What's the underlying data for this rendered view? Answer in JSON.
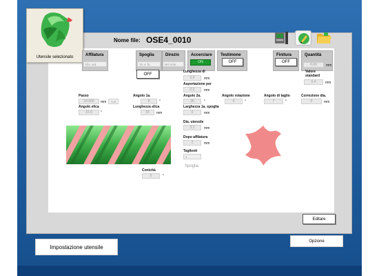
{
  "tool_card": {
    "caption": "Utensile selezionato"
  },
  "header": {
    "file_label": "Nome file:",
    "file_value": "OSE4_0010"
  },
  "columns": {
    "affilatura": {
      "label": "Affilatura",
      "value": "Ris. aut"
    },
    "spoglia": {
      "label": "Spoglia",
      "value": "Ta. e Ta",
      "off": "OFF"
    },
    "direzione": {
      "label": "Direzio",
      "value": "Nel sole"
    },
    "accerciare": {
      "label": "Accerciare",
      "value": "ON"
    },
    "testimone": {
      "label": "Testimone",
      "off": "OFF"
    },
    "finitura": {
      "label": "Finitura",
      "off": "OFF"
    },
    "quantita": {
      "label": "Quantità",
      "value": "0.00",
      "unit": "mm"
    }
  },
  "fields": {
    "lunghezza_di": {
      "label": "Lunghezza di",
      "value": "0.0",
      "unit": "mm"
    },
    "valore_standard": {
      "label": "Valore standard",
      "value": "0.4",
      "unit": "mm"
    },
    "asportazione_per": {
      "label": "Asportazione per",
      "value": "0.2",
      "unit": "mm"
    },
    "passo": {
      "label": "Passo",
      "value": "10.000",
      "unit": "mm",
      "calc": "Cal"
    },
    "angolo_1a": {
      "label": "Angolo 1a.",
      "value": "8",
      "unit": "°"
    },
    "angolo_2a": {
      "label": "Angolo 2a.",
      "value": "26",
      "unit": "°"
    },
    "angolo_rotazione": {
      "label": "Angolo rotazione",
      "value": "0",
      "unit": "°"
    },
    "angolo_taglio": {
      "label": "Angolo di taglio",
      "value": "7",
      "unit": "°"
    },
    "correzione_dia": {
      "label": "Correzione dia.",
      "value": "0",
      "unit": "mm"
    },
    "angolo_elica": {
      "label": "Angolo elica",
      "value": "15.0",
      "unit": "°"
    },
    "lunghezza_elica": {
      "label": "Lunghezza elica",
      "value": "15",
      "unit": "mm"
    },
    "lunghezza_1a_spoglia": {
      "label": "Larghezza 1a. spoglia",
      "value": "0",
      "unit": "mm"
    },
    "dia_utensile": {
      "label": "Dia. utensile",
      "value": "3.1",
      "unit": "mm"
    },
    "dopo_affilatura": {
      "label": "Dopo affilatura",
      "value": "2",
      "unit": "mm"
    },
    "taglienti": {
      "label": "Taglienti",
      "value": "4"
    },
    "spoglia_sel": {
      "value": "Spoglia"
    },
    "conicita": {
      "label": "Conicità",
      "value": "0",
      "unit": "°"
    }
  },
  "buttons": {
    "editare": "Editare",
    "impostazione": "Impostazione utensile",
    "opzione": "Opzione"
  },
  "colors": {
    "accent_green": "#1c9a2d",
    "flute_pink": "#f08a8a",
    "helix_green": "#3fae4a"
  }
}
